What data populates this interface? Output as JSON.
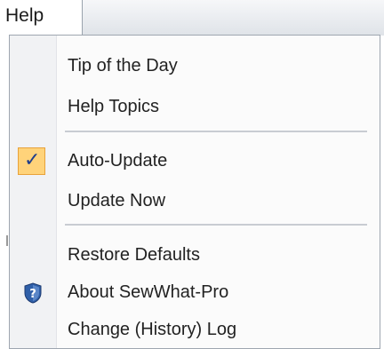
{
  "menubar": {
    "help_label": "Help"
  },
  "menu": {
    "tip_of_the_day": "Tip of the Day",
    "help_topics": "Help Topics",
    "auto_update": "Auto-Update",
    "auto_update_checked": true,
    "check_glyph": "✓",
    "update_now": "Update Now",
    "restore_defaults": "Restore Defaults",
    "about": "About SewWhat-Pro",
    "change_log": "Change (History) Log"
  },
  "colors": {
    "check_bg": "#ffd37a",
    "check_border": "#e8a23a",
    "shield": "#2f5fa8"
  }
}
